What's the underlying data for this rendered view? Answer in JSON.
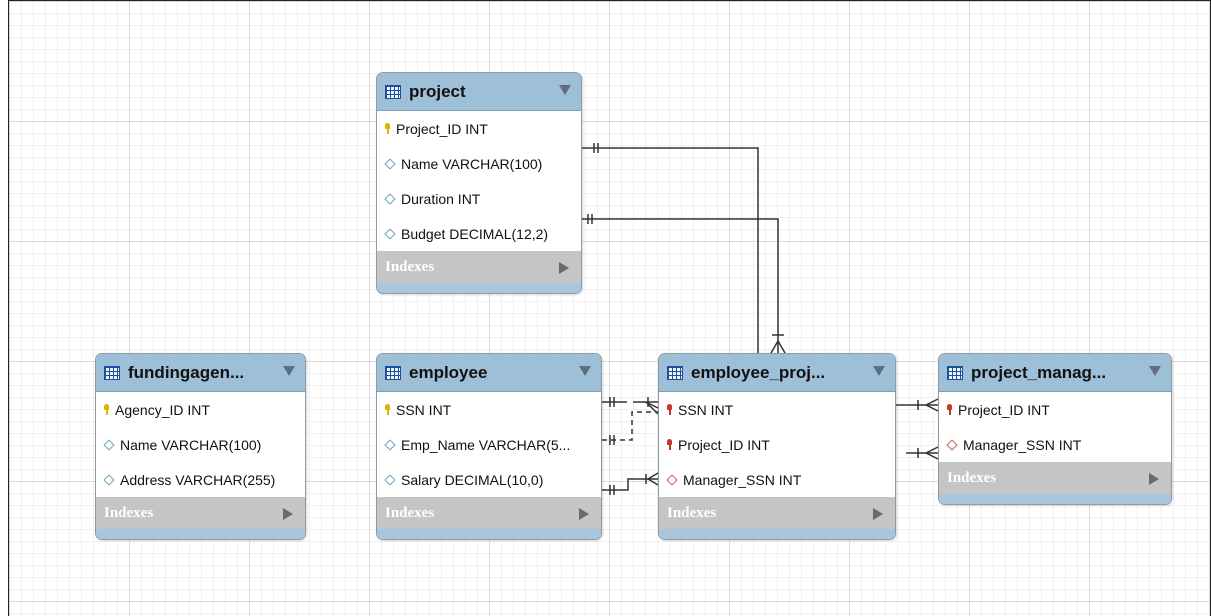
{
  "diagram": {
    "tables": [
      {
        "id": "project",
        "title": "project",
        "columns": [
          {
            "text": "Project_ID INT",
            "icon": "primary-key-icon"
          },
          {
            "text": "Name VARCHAR(100)",
            "icon": "column-diamond-icon"
          },
          {
            "text": "Duration INT",
            "icon": "column-diamond-icon"
          },
          {
            "text": "Budget DECIMAL(12,2)",
            "icon": "column-diamond-icon"
          }
        ],
        "indexes_label": "Indexes"
      },
      {
        "id": "fundingagency",
        "title": "fundingagen...",
        "columns": [
          {
            "text": "Agency_ID INT",
            "icon": "primary-key-icon"
          },
          {
            "text": "Name VARCHAR(100)",
            "icon": "column-diamond-icon"
          },
          {
            "text": "Address VARCHAR(255)",
            "icon": "column-diamond-icon"
          }
        ],
        "indexes_label": "Indexes"
      },
      {
        "id": "employee",
        "title": "employee",
        "columns": [
          {
            "text": "SSN INT",
            "icon": "primary-key-icon"
          },
          {
            "text": "Emp_Name VARCHAR(5...",
            "icon": "column-diamond-icon"
          },
          {
            "text": "Salary DECIMAL(10,0)",
            "icon": "column-diamond-icon"
          }
        ],
        "indexes_label": "Indexes"
      },
      {
        "id": "employee_project",
        "title": "employee_proj...",
        "columns": [
          {
            "text": "SSN INT",
            "icon": "foreign-key-icon"
          },
          {
            "text": "Project_ID INT",
            "icon": "foreign-key-icon"
          },
          {
            "text": "Manager_SSN INT",
            "icon": "foreign-column-diamond-icon"
          }
        ],
        "indexes_label": "Indexes"
      },
      {
        "id": "project_manager",
        "title": "project_manag...",
        "columns": [
          {
            "text": "Project_ID INT",
            "icon": "foreign-key-icon"
          },
          {
            "text": "Manager_SSN INT",
            "icon": "foreign-column-diamond-icon"
          }
        ],
        "indexes_label": "Indexes"
      }
    ],
    "colors": {
      "header": "#9ebfd8",
      "indexes_bar": "#c5c5c5",
      "primary_key": "#e0b300",
      "foreign_key": "#c0392b",
      "relationship_line": "#333333"
    }
  }
}
